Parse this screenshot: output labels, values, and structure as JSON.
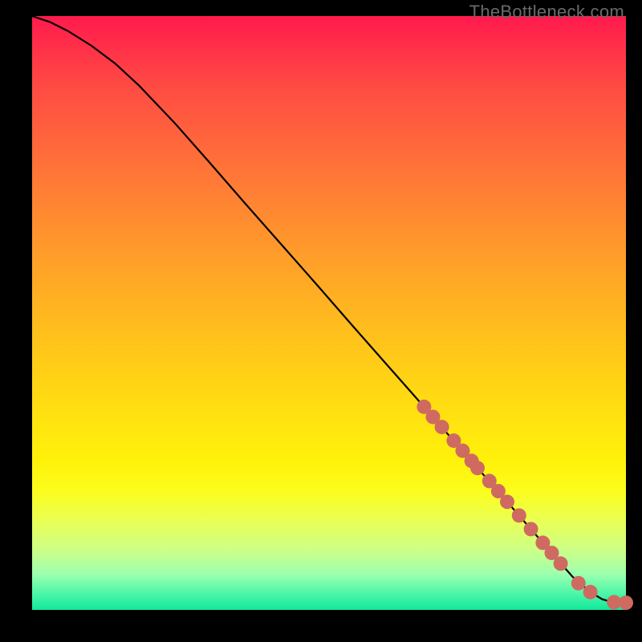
{
  "watermark": "TheBottleneck.com",
  "colors": {
    "marker": "#cf6a61",
    "curve": "#000000"
  },
  "chart_data": {
    "type": "line",
    "title": "",
    "xlabel": "",
    "ylabel": "",
    "xlim": [
      0,
      100
    ],
    "ylim": [
      0,
      100
    ],
    "grid": false,
    "series": [
      {
        "name": "curve",
        "x": [
          0,
          3,
          6,
          10,
          14,
          18,
          24,
          30,
          36,
          42,
          48,
          54,
          60,
          66,
          72,
          78,
          84,
          88,
          91,
          94,
          96,
          98,
          100
        ],
        "y": [
          100,
          99,
          97.5,
          95,
          92,
          88.3,
          82,
          75.2,
          68.3,
          61.5,
          54.7,
          47.8,
          41,
          34.2,
          27.3,
          20.5,
          13.6,
          9,
          5.6,
          3,
          1.8,
          1.2,
          1.2
        ]
      }
    ],
    "markers": {
      "name": "highlight-points",
      "x": [
        66,
        67.5,
        69,
        71,
        72.5,
        74,
        75,
        77,
        78.5,
        80,
        82,
        84,
        86,
        87.5,
        89,
        92,
        94,
        98,
        100
      ],
      "y": [
        34.2,
        32.5,
        30.8,
        28.5,
        26.8,
        25.1,
        23.9,
        21.7,
        20,
        18.2,
        15.9,
        13.6,
        11.3,
        9.6,
        7.8,
        4.5,
        3,
        1.3,
        1.2
      ]
    }
  }
}
